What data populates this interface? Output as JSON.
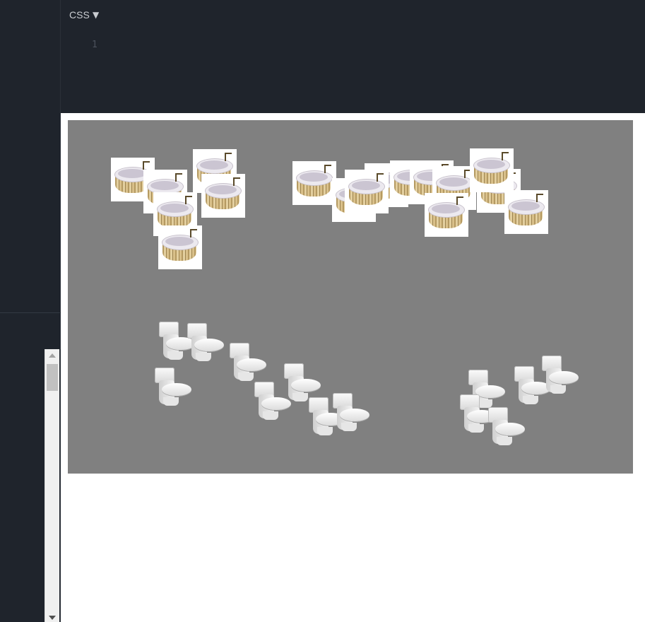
{
  "editor": {
    "panel_title": "CSS",
    "dropdown_glyph": "▼",
    "line_numbers": [
      "1"
    ]
  },
  "preview": {
    "background": "#808080",
    "objects": {
      "bathtub_count": 17,
      "toilet_count": 15
    }
  }
}
